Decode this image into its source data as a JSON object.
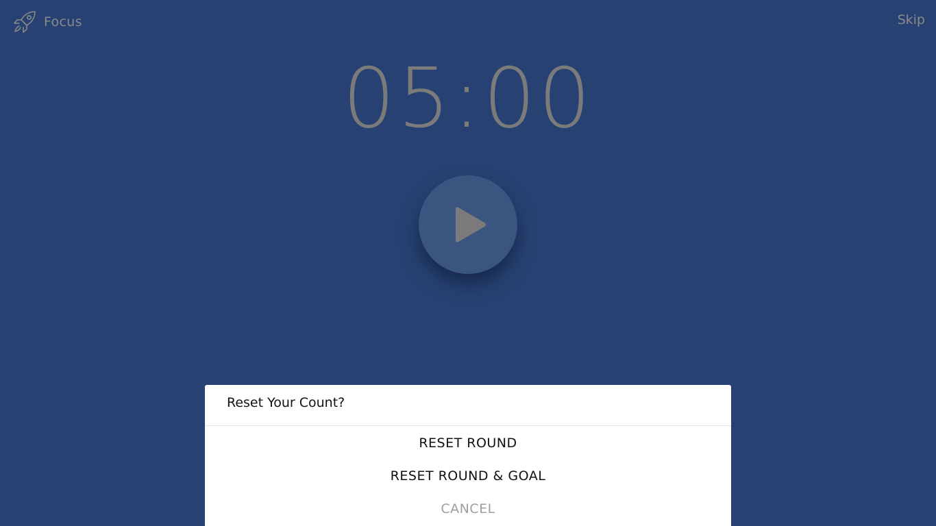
{
  "header": {
    "mode_label": "Focus",
    "mode_icon": "rocket-icon",
    "skip_label": "Skip"
  },
  "timer": {
    "display": "05:00"
  },
  "controls": {
    "play_icon": "play-icon"
  },
  "dialog": {
    "title": "Reset Your Count?",
    "options": [
      "RESET ROUND",
      "RESET ROUND & GOAL"
    ],
    "cancel_label": "CANCEL"
  },
  "colors": {
    "background": "#274272",
    "muted_text": "#8a8a8a",
    "play_button": "#3a5580",
    "dialog_bg": "#ffffff",
    "cancel_text": "#9e9e9e"
  }
}
